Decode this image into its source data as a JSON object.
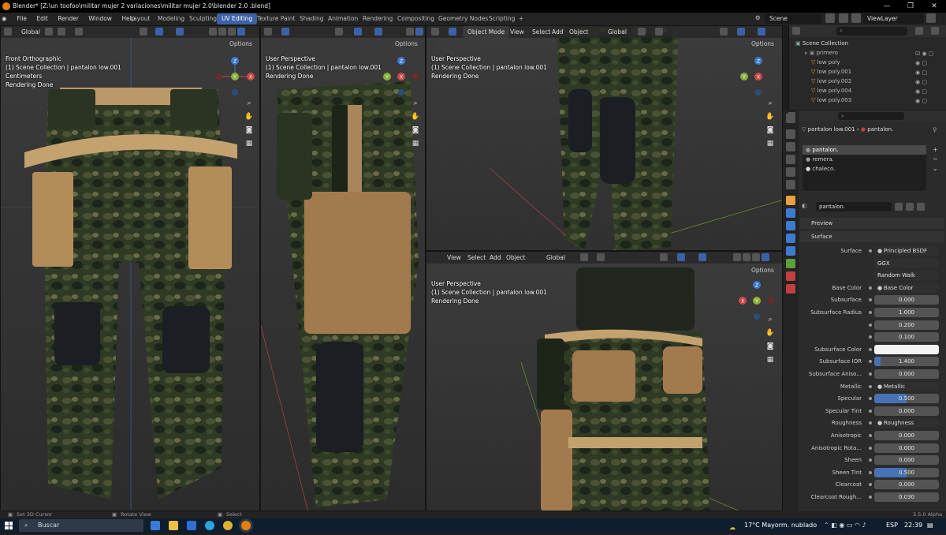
{
  "window": {
    "title": "Blender* [Z:\\un toofoo\\militar mujer 2 variaciones\\militar mujer 2.0\\blender 2.0 .blend]",
    "controls": [
      "—",
      "❐",
      "✕"
    ]
  },
  "menu": [
    "File",
    "Edit",
    "Render",
    "Window",
    "Help"
  ],
  "workspaces": [
    "Layout",
    "Modeling",
    "Sculpting",
    "UV Editing",
    "Texture Paint",
    "Shading",
    "Animation",
    "Rendering",
    "Compositing",
    "Geometry Nodes",
    "Scripting",
    "+"
  ],
  "active_workspace": "UV Editing",
  "scene": {
    "label": "Scene",
    "viewlayer": "ViewLayer"
  },
  "viewports": [
    {
      "header": {
        "orientation": "Global",
        "options": "Options"
      },
      "info": [
        "Front Orthographic",
        "(1) Scene Collection | pantalon low.001",
        "Centimeters",
        "Rendering Done"
      ]
    },
    {
      "header": {
        "options": "Options"
      },
      "info": [
        "User Perspective",
        "(1) Scene Collection | pantalon low.001",
        "Rendering Done"
      ]
    },
    {
      "header": {
        "mode": "Object Mode",
        "view": "View",
        "select": "Select",
        "add": "Add",
        "object": "Object",
        "orientation": "Global",
        "options": "Options"
      },
      "info": [
        "User Perspective",
        "(1) Scene Collection | pantalon low.001",
        "Rendering Done"
      ]
    },
    {
      "header": {
        "view": "View",
        "select": "Select",
        "add": "Add",
        "object": "Object",
        "orientation": "Global",
        "options": "Options"
      },
      "info": [
        "User Perspective",
        "(1) Scene Collection | pantalon low.001",
        "Rendering Done"
      ]
    }
  ],
  "gizmo_axes": {
    "x": "X",
    "y": "Y",
    "z": "Z"
  },
  "outliner": {
    "title": "Scene Collection",
    "items": [
      "primero",
      "low poly",
      "low poly.001",
      "low poly.002",
      "low poly.004",
      "low poly.003"
    ]
  },
  "properties": {
    "breadcrumb": {
      "object": "pantalon low.001",
      "material": "pantalon."
    },
    "slots": [
      "pantalon.",
      "remera.",
      "chaleco."
    ],
    "material_name": "pantalon.",
    "preview": "Preview",
    "surface_panel": "Surface",
    "rows": [
      {
        "label": "Surface",
        "value": "Principled BSDF",
        "kind": "link"
      },
      {
        "label": "",
        "value": "GGX",
        "kind": "dropdown"
      },
      {
        "label": "",
        "value": "Random Walk",
        "kind": "dropdown"
      },
      {
        "label": "Base Color",
        "value": "Base Color",
        "kind": "link"
      },
      {
        "label": "Subsurface",
        "value": "0.000",
        "kind": "num"
      },
      {
        "label": "Subsurface Radius",
        "value": "1.000",
        "kind": "num"
      },
      {
        "label": "",
        "value": "0.200",
        "kind": "num"
      },
      {
        "label": "",
        "value": "0.100",
        "kind": "num"
      },
      {
        "label": "Subsurface Color",
        "value": "",
        "kind": "white"
      },
      {
        "label": "Subsurface IOR",
        "value": "1.400",
        "kind": "num"
      },
      {
        "label": "Subsurface Aniso...",
        "value": "0.000",
        "kind": "num"
      },
      {
        "label": "Metallic",
        "value": "Metallic",
        "kind": "link"
      },
      {
        "label": "Specular",
        "value": "0.500",
        "kind": "blue"
      },
      {
        "label": "Specular Tint",
        "value": "0.000",
        "kind": "num"
      },
      {
        "label": "Roughness",
        "value": "Roughness",
        "kind": "link"
      },
      {
        "label": "Anisotropic",
        "value": "0.000",
        "kind": "num"
      },
      {
        "label": "Anisotropic Rota...",
        "value": "0.000",
        "kind": "num"
      },
      {
        "label": "Sheen",
        "value": "0.000",
        "kind": "num"
      },
      {
        "label": "Sheen Tint",
        "value": "0.500",
        "kind": "blue"
      },
      {
        "label": "Clearcoat",
        "value": "0.000",
        "kind": "num"
      },
      {
        "label": "Clearcoat Rough...",
        "value": "0.030",
        "kind": "num"
      }
    ]
  },
  "statusbar": {
    "left": "Set 3D Cursor",
    "mid": "Rotate View",
    "right": "Select",
    "version": "3.5.0 Alpha"
  },
  "taskbar": {
    "search": "Buscar",
    "weather": "17°C  Mayorm. nublado",
    "lang": "ESP",
    "time": "22:39"
  }
}
